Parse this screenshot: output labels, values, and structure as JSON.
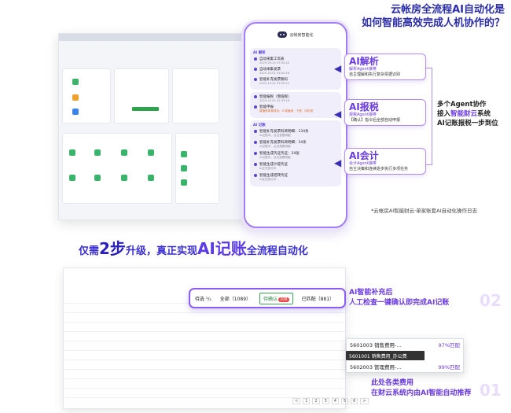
{
  "headline": {
    "line1": "云帐房全流程AI自动化是",
    "line2": "如何智能高效完成人机协作的？"
  },
  "phone": {
    "title": "云帐房智能化",
    "stages": [
      {
        "tag": "AI 解析",
        "steps": [
          {
            "title": "自动采集工资表",
            "sub": "2025-09-25 07:00:10"
          },
          {
            "title": "自动采集发票",
            "sub": "2025-10-01 04:00:16"
          },
          {
            "title": "智能补充发票税码",
            "sub": "2022-10-01 05:00:12"
          }
        ]
      },
      {
        "tag": "",
        "steps": [
          {
            "title": "智能报税（增值税）",
            "sub": "2025-10-01 01:33:16"
          },
          {
            "title": "智能申报",
            "sub": "",
            "highlight": "增值税申报成功：¥ 增值税、个税、印花税"
          }
        ]
      },
      {
        "tag": "AI 记账",
        "steps": [
          {
            "title": "智能补充发票科目明细：134条",
            "sub": "AI记账中，点击查看明细"
          },
          {
            "title": "智能补充发票科目明细：34条",
            "sub": "AI记账中，点击查看明细"
          },
          {
            "title": "智能生成凭证凭证：24张",
            "sub": "AI记账中，点击查看明细"
          },
          {
            "title": "智能生成计提凭证",
            "sub": "AI正在执行中"
          },
          {
            "title": "智能生成结转凭证",
            "sub": "AI正在执行中"
          }
        ]
      }
    ]
  },
  "callouts": {
    "parse": {
      "ai": "AI解析",
      "l1": "解析Agent接棒",
      "l2": "自主理解和执行复杂票据识别"
    },
    "tax": {
      "ai": "AI报税",
      "l1": "报税Agent接棒",
      "l2": "【确认】指令后全部自动申报"
    },
    "accounting": {
      "ai": "AI会计",
      "l1": "会计Agent接棒",
      "l2": "自主决策和连续逐步执行多项任务"
    }
  },
  "side_note": {
    "line1": "多个Agent协作",
    "line2a": "接入",
    "line2b": "智能财云",
    "line2c": "系统",
    "line3": "AI记账报税一步到位"
  },
  "footnote": "*云帐房AI智能财云·单家账套AI自动化操作日志",
  "tagline": {
    "pre": "仅需",
    "big": "2步",
    "mid": "升级，真正实现",
    "ai": "AI记账",
    "post": "全流程自动化"
  },
  "filter_bar": {
    "label": "待选 ¹/₂",
    "tabs": [
      {
        "label": "全部（1089）"
      },
      {
        "label": "待确认",
        "badge": "208",
        "active": true
      },
      {
        "label": "已匹配（881）"
      }
    ]
  },
  "dropdown": {
    "rows": [
      {
        "code": "5601003 销售费用-…",
        "pct": "97%匹配"
      },
      {
        "code": "5602003 管理费用-…",
        "pct": "99%匹配"
      }
    ],
    "tooltip": "5601001 销售费用_办公费"
  },
  "right_text1": {
    "line1": "AI智能补充后",
    "line2": "人工检查一键确认即完成AI记账"
  },
  "right_text2": {
    "line1": "此处各类费用",
    "line2": "在财云系统内由AI智能自动推荐"
  },
  "step_numbers": {
    "n1": "01",
    "n2": "02"
  },
  "pager": [
    "<",
    "1",
    "2",
    "3",
    "4",
    "5",
    "6",
    ">"
  ]
}
